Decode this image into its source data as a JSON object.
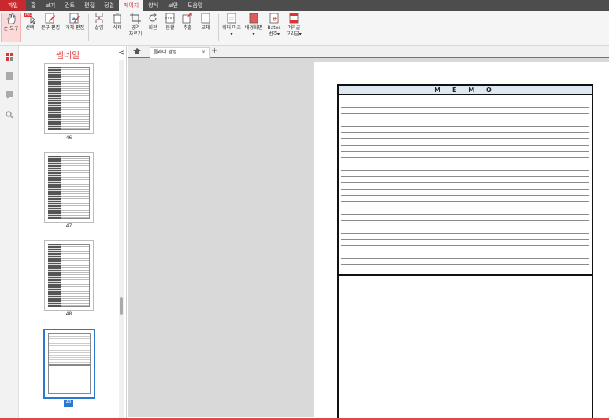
{
  "menu": [
    "파일",
    "홈",
    "보기",
    "검토",
    "편집",
    "정렬",
    "페이지",
    "양식",
    "보안",
    "도움말"
  ],
  "ribbon": {
    "hand": "손 도구",
    "select": "선택",
    "select_badge": "PRO",
    "text_edit": "문구 편집",
    "object_edit": "개체 편집",
    "insert": "삽입",
    "delete": "삭제",
    "crop_1": "영역",
    "crop_2": "자르기",
    "rotate": "회전",
    "split": "분할",
    "extract": "추출",
    "replace": "교체",
    "watermark": "워터 마크",
    "background": "배경화면",
    "bates_1": "Bates",
    "bates_2": "번호",
    "header_1": "머리글",
    "header_2": "꼬리글"
  },
  "thumbnails": {
    "title": "썸네일",
    "pages": [
      "46",
      "47",
      "48"
    ],
    "selected_page": "49"
  },
  "tab": {
    "label": "플래너 완성",
    "close": "×",
    "add": "+"
  },
  "document": {
    "memo_title": "M E M O"
  },
  "colors": {
    "accent": "#e04747",
    "file_tab": "#c8292e",
    "selected_thumb": "#2b78d0",
    "memo_header": "#dde8f2"
  }
}
